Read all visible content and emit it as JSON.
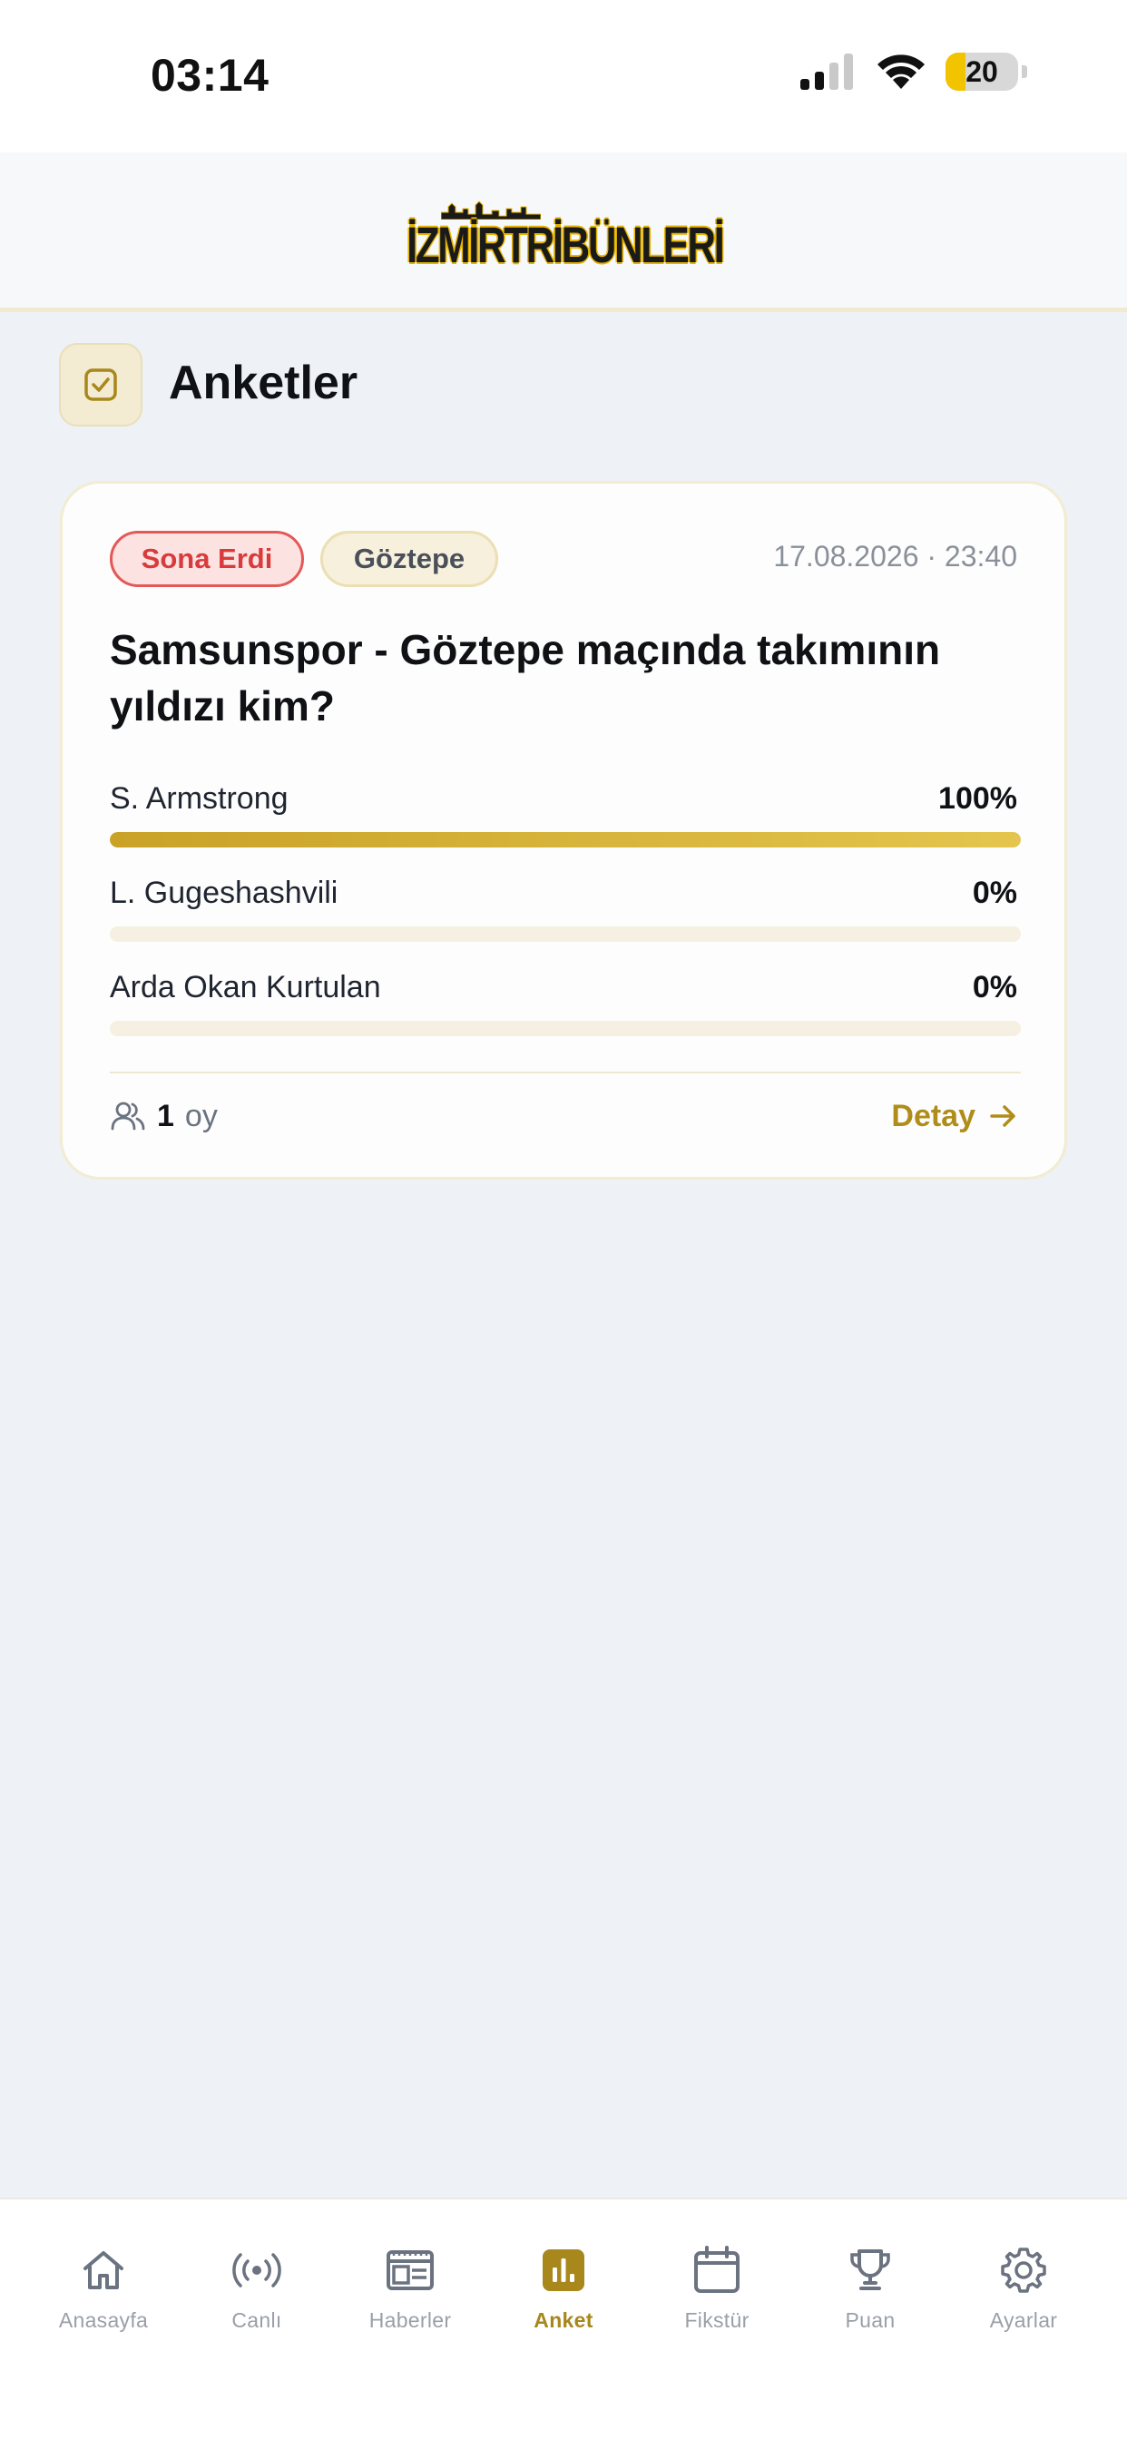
{
  "status_bar": {
    "time": "03:14",
    "battery": "20",
    "icons": [
      "cellular-signal-icon",
      "wifi-icon",
      "battery-icon"
    ]
  },
  "header": {
    "logo_text": "İZMİRTRİBÜNLERİ"
  },
  "page": {
    "title": "Anketler",
    "title_icon": "checkbox-icon"
  },
  "poll": {
    "status_badge": "Sona Erdi",
    "team_badge": "Göztepe",
    "date": "17.08.2026 · 23:40",
    "question": "Samsunspor - Göztepe maçında takımının yıldızı kim?",
    "options": [
      {
        "label": "S. Armstrong",
        "percent": "100%",
        "value": 1.0
      },
      {
        "label": "L. Gugeshashvili",
        "percent": "0%",
        "value": 0.0
      },
      {
        "label": "Arda Okan Kurtulan",
        "percent": "0%",
        "value": 0.0
      }
    ],
    "vote_count": "1",
    "vote_label": "oy",
    "detail_label": "Detay"
  },
  "tabs": [
    {
      "label": "Anasayfa",
      "icon": "home-icon",
      "active": false
    },
    {
      "label": "Canlı",
      "icon": "live-broadcast-icon",
      "active": false
    },
    {
      "label": "Haberler",
      "icon": "newspaper-icon",
      "active": false
    },
    {
      "label": "Anket",
      "icon": "poll-chart-icon",
      "active": true
    },
    {
      "label": "Fikstür",
      "icon": "calendar-icon",
      "active": false
    },
    {
      "label": "Puan",
      "icon": "trophy-icon",
      "active": false
    },
    {
      "label": "Ayarlar",
      "icon": "settings-gear-icon",
      "active": false
    }
  ],
  "colors": {
    "accent": "#b08d1a",
    "ended_red": "#d83b3b",
    "background": "#eef1f5"
  }
}
